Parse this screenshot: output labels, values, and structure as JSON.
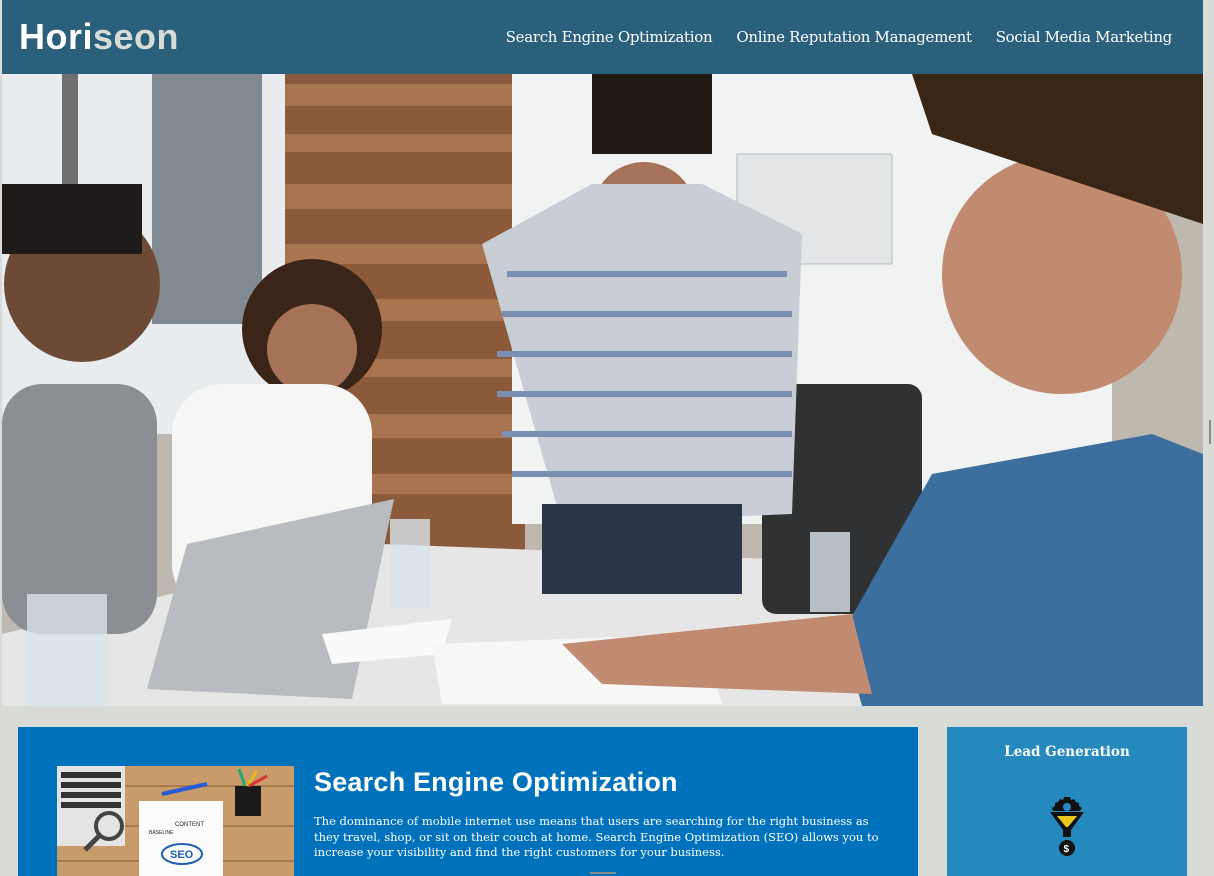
{
  "header": {
    "brand_part1": "Hori",
    "brand_part2": "seon",
    "nav": [
      {
        "label": "Search Engine Optimization"
      },
      {
        "label": "Online Reputation Management"
      },
      {
        "label": "Social Media Marketing"
      }
    ]
  },
  "hero": {
    "image": "people-working-around-table-photo"
  },
  "content": {
    "seo": {
      "title": "Search Engine Optimization",
      "text": "The dominance of mobile internet use means that users are searching for the right business as they travel, shop, or sit on their couch at home. Search Engine Optimization (SEO) allows you to increase your visibility and find the right customers for your business.",
      "image": "seo-desk-illustration",
      "image_labels": {
        "content": "CONTENT",
        "baseline": "BASELINE",
        "seo": "SEO"
      }
    }
  },
  "aside": {
    "title": "Lead Generation",
    "icon": "lead-generation-funnel-icon"
  },
  "colors": {
    "header_bg": "#2a607c",
    "page_bg": "#d9dcd6",
    "content_bg": "#0072bb",
    "aside_bg": "#2589bd",
    "text": "#ffffff"
  }
}
